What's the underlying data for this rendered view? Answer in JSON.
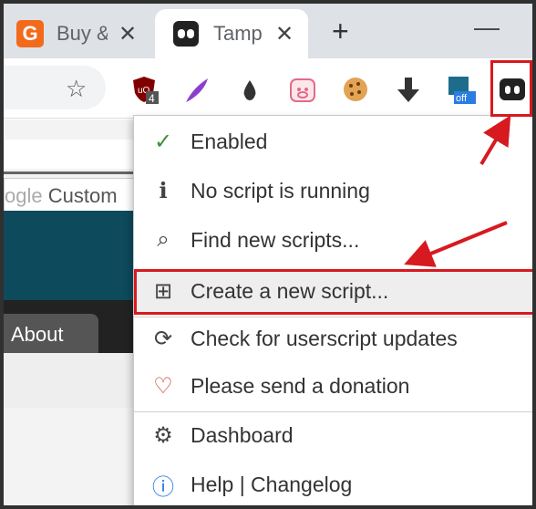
{
  "tabs": [
    {
      "title": "Buy &",
      "favicon": "g-favicon-icon",
      "close": "✕"
    },
    {
      "title": "Tamp",
      "favicon": "tampermonkey-icon",
      "close": "✕"
    }
  ],
  "new_tab_label": "+",
  "minimize_label": "—",
  "toolbar": {
    "star": "☆",
    "extensions": [
      {
        "name": "ublock-extension-icon",
        "badge": "4"
      },
      {
        "name": "feather-extension-icon"
      },
      {
        "name": "drop-extension-icon"
      },
      {
        "name": "pig-extension-icon"
      },
      {
        "name": "cookie-extension-icon"
      },
      {
        "name": "download-extension-icon"
      },
      {
        "name": "screenshot-extension-icon",
        "badge": "off"
      },
      {
        "name": "tampermonkey-extension-icon"
      }
    ]
  },
  "page": {
    "search_prefix": "ogle",
    "search_text": "Custom",
    "about_label": "About"
  },
  "menu": {
    "items": [
      {
        "icon": "✓",
        "icon_name": "check-icon",
        "label": "Enabled"
      },
      {
        "icon": "ℹ",
        "icon_name": "bug-icon",
        "label": "No script is running"
      },
      {
        "icon": "⌕",
        "icon_name": "search-icon",
        "label": "Find new scripts..."
      },
      {
        "icon": "⊞",
        "icon_name": "plus-square-icon",
        "label": "Create a new script..."
      },
      {
        "icon": "⟳",
        "icon_name": "refresh-icon",
        "label": "Check for userscript updates"
      },
      {
        "icon": "♡",
        "icon_name": "heart-icon",
        "label": "Please send a donation"
      },
      {
        "icon": "⚙",
        "icon_name": "gear-icon",
        "label": "Dashboard"
      },
      {
        "icon": "ⓘ",
        "icon_name": "info-icon",
        "label": "Help | Changelog"
      }
    ]
  },
  "colors": {
    "accent_red": "#d71920",
    "check_green": "#3c8f3c",
    "heart_red": "#c0392b",
    "info_blue": "#1a73e8",
    "teal": "#0d4a5c"
  }
}
